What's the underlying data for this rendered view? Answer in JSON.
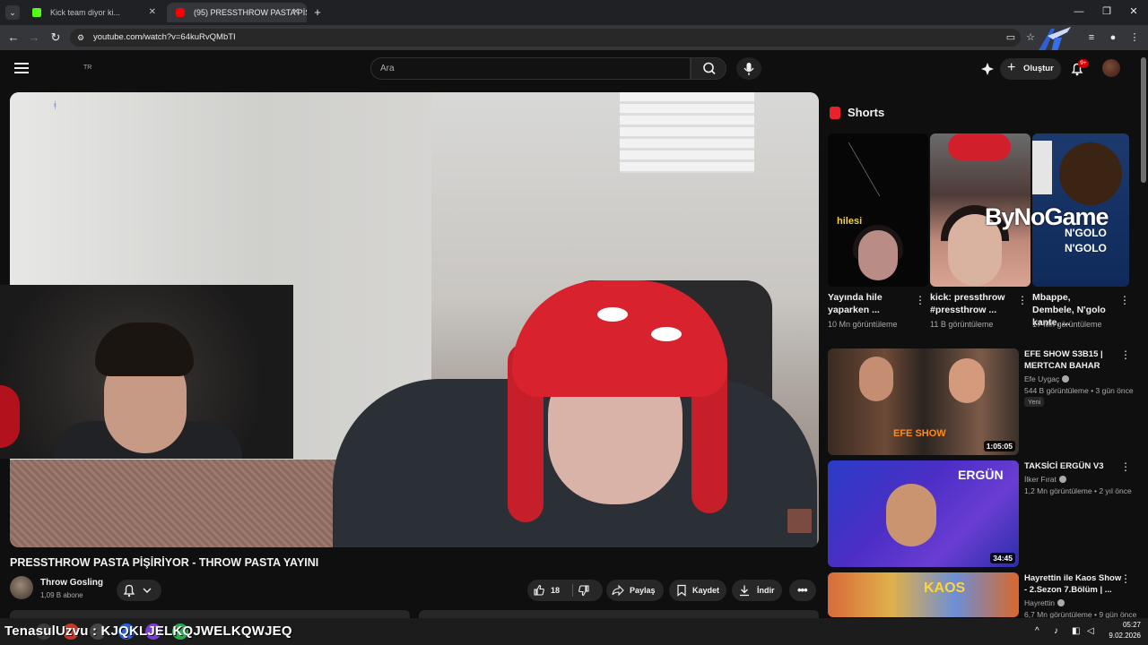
{
  "browser": {
    "tabs": [
      {
        "title": "Kick team diyor ki...",
        "icon_color": "#53fc18"
      },
      {
        "title": "(95) PRESSTHROW PASTA PİŞİRİ...",
        "icon_color": "#ff0000",
        "active": true
      }
    ],
    "url": "youtube.com/watch?v=64kuRvQMbTI"
  },
  "youtube": {
    "country_code": "TR",
    "search_placeholder": "Ara",
    "create_label": "Oluştur",
    "notifications_badge": "9+"
  },
  "video": {
    "title": "PRESSTHROW PASTA PİŞİRİYOR - THROW PASTA YAYINI",
    "channel_name": "Throw Gosling",
    "subscribers": "1,09 B abone",
    "likes": "18",
    "share_label": "Paylaş",
    "save_label": "Kaydet",
    "download_label": "İndir"
  },
  "shorts": {
    "section_title": "Shorts",
    "items": [
      {
        "title": "Yayında hile yaparken ...",
        "views": "10 Mn görüntüleme",
        "overlay_text": "hilesi"
      },
      {
        "title": "kick: pressthrow #pressthrow ...",
        "views": "11 B görüntüleme"
      },
      {
        "title": "Mbappe, Dembele, N'golo kante, ...",
        "views": "17 Mn görüntüleme",
        "overlay_text": "ByNoGame",
        "overlay_text2": "N'GOLO",
        "overlay_text3": "N'GOLO"
      }
    ]
  },
  "recommended": [
    {
      "title": "EFE SHOW S3B15 | MERTCAN BAHAR",
      "channel": "Efe Uygaç",
      "views": "544 B görüntüleme",
      "age": "3 gün önce",
      "badge": "Yeni",
      "duration": "1:05:05",
      "thumb_text": "EFE SHOW"
    },
    {
      "title": "TAKSİCİ ERGÜN V3",
      "channel": "İlker Fırat",
      "views": "1,2 Mn görüntüleme",
      "age": "2 yıl önce",
      "duration": "34:45",
      "thumb_text": "ERGÜN"
    },
    {
      "title": "Hayrettin ile Kaos Show - 2.Sezon 7.Bölüm | ...",
      "channel": "Hayrettin",
      "views": "6,7 Mn görüntüleme",
      "age": "9 gün önce",
      "thumb_text": "KAOS"
    }
  ],
  "taskbar": {
    "overlay_text": "TenasulUzvu : KJQKLJELKQJWELKQWJEQ",
    "time": "05:27",
    "date": "9.02.2026"
  }
}
